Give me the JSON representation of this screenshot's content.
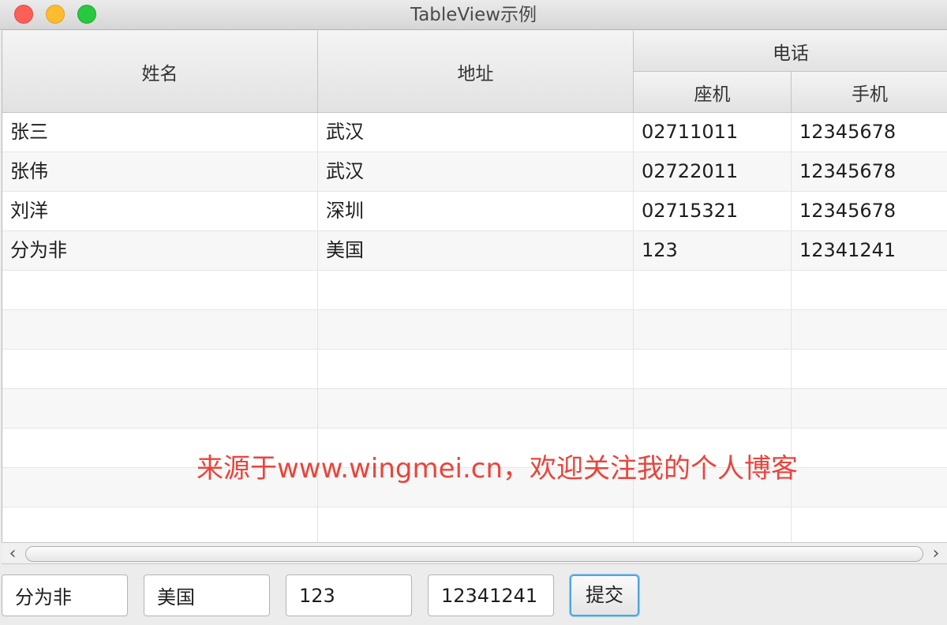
{
  "window": {
    "title": "TableView示例"
  },
  "table": {
    "columns": {
      "name": "姓名",
      "address": "地址",
      "phone_group": "电话",
      "landline": "座机",
      "mobile": "手机"
    },
    "rows": [
      [
        "张三",
        "武汉",
        "02711011",
        "12345678"
      ],
      [
        "张伟",
        "武汉",
        "02722011",
        "12345678"
      ],
      [
        "刘洋",
        "深圳",
        "02715321",
        "12345678"
      ],
      [
        "分为非",
        "美国",
        "123",
        "12341241"
      ]
    ],
    "empty_rows": 7
  },
  "form": {
    "name_value": "分为非",
    "address_value": "美国",
    "landline_value": "123",
    "mobile_value": "12341241",
    "submit_label": "提交"
  },
  "watermark": "来源于www.wingmei.cn，欢迎关注我的个人博客"
}
